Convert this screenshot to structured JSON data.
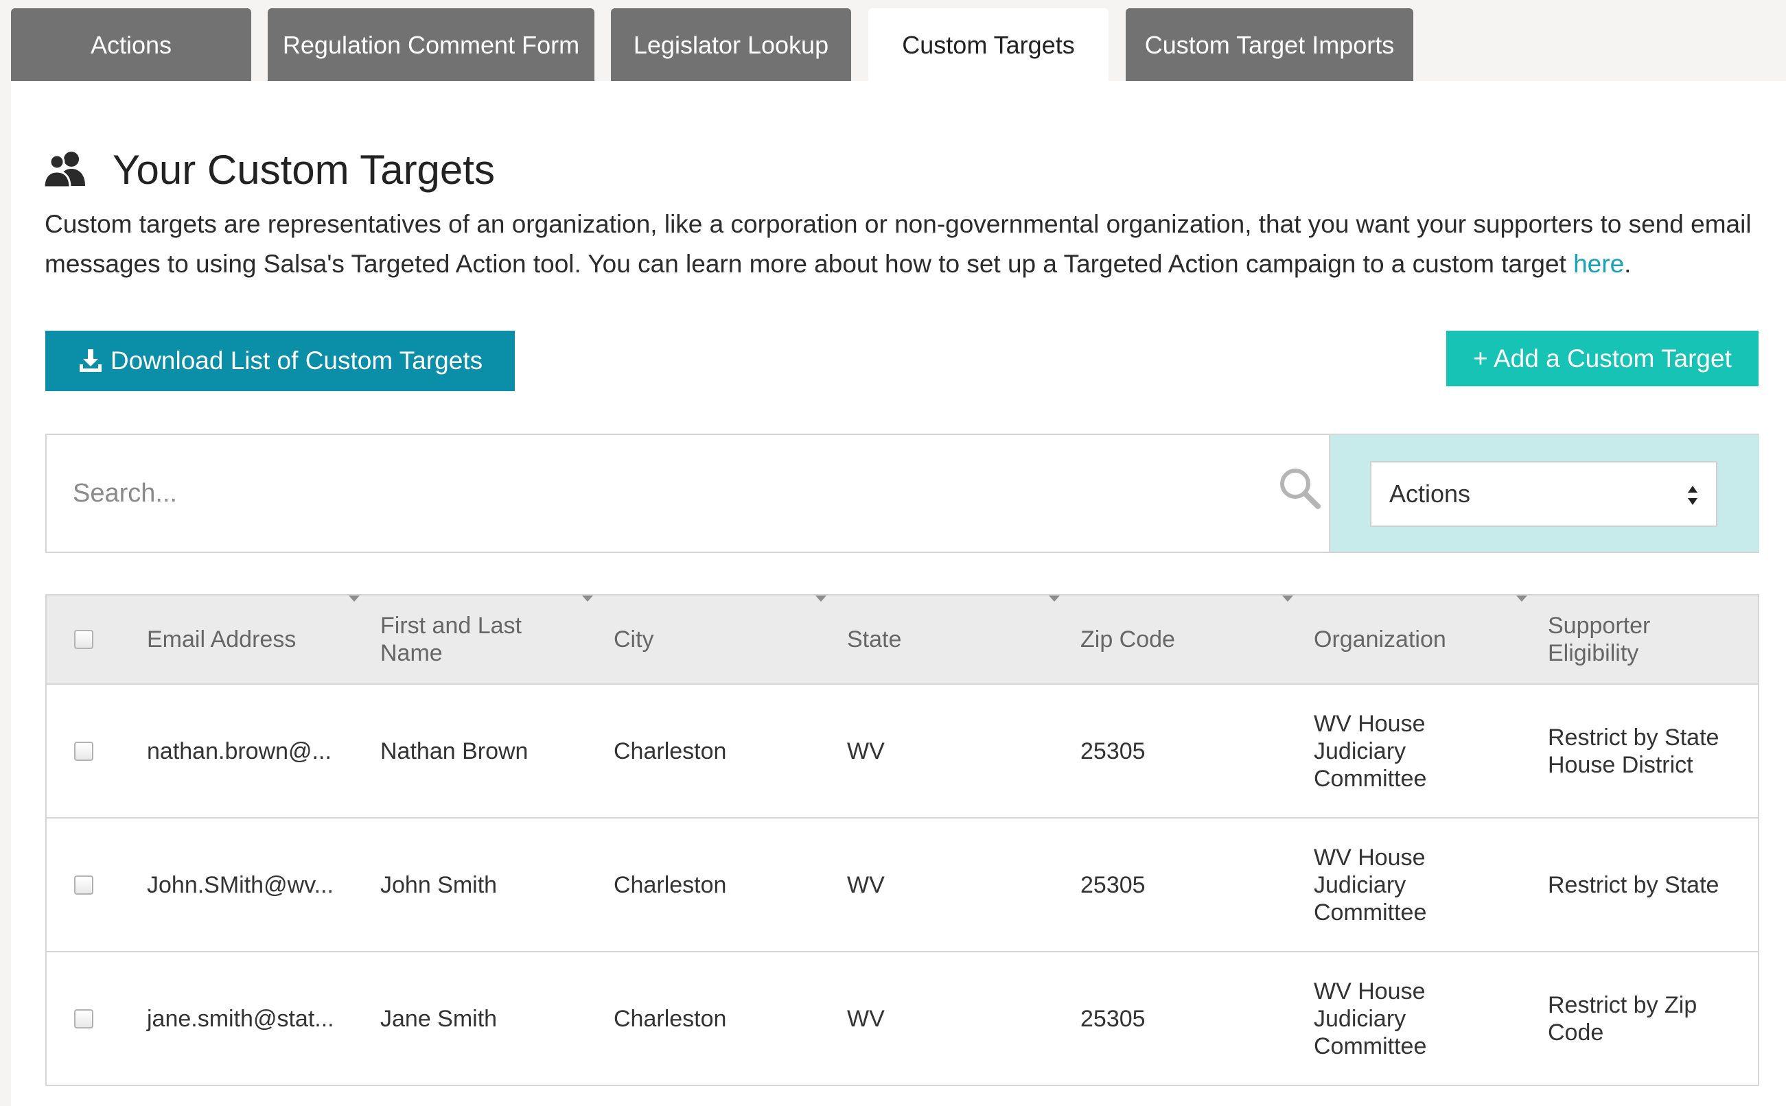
{
  "tabs": [
    {
      "label": "Actions"
    },
    {
      "label": "Regulation Comment Form"
    },
    {
      "label": "Legislator Lookup"
    },
    {
      "label": "Custom Targets",
      "active": true
    },
    {
      "label": "Custom Target Imports"
    }
  ],
  "page": {
    "title": "Your Custom Targets",
    "description": "Custom targets are representatives of an organization, like a corporation or non-governmental organization, that you want your supporters to send email messages to using Salsa's Targeted Action tool. You can learn more about how to set up a Targeted Action campaign to a custom target ",
    "link_text": "here",
    "description_end": "."
  },
  "buttons": {
    "download": "Download List of Custom Targets",
    "add": "+ Add a Custom Target"
  },
  "search": {
    "placeholder": "Search...",
    "actions_selected": "Actions"
  },
  "table": {
    "headers": {
      "email": "Email Address",
      "name": "First and Last Name",
      "city": "City",
      "state": "State",
      "zip": "Zip Code",
      "organization": "Organization",
      "eligibility": "Supporter Eligibility"
    },
    "rows": [
      {
        "email": "nathan.brown@...",
        "name": "Nathan Brown",
        "city": "Charleston",
        "state": "WV",
        "zip": "25305",
        "organization": "WV House Judiciary Committee",
        "eligibility": "Restrict by State House District"
      },
      {
        "email": "John.SMith@wv...",
        "name": "John Smith",
        "city": "Charleston",
        "state": "WV",
        "zip": "25305",
        "organization": "WV House Judiciary Committee",
        "eligibility": "Restrict by State"
      },
      {
        "email": "jane.smith@stat...",
        "name": "Jane Smith",
        "city": "Charleston",
        "state": "WV",
        "zip": "25305",
        "organization": "WV House Judiciary Committee",
        "eligibility": "Restrict by Zip Code"
      }
    ]
  },
  "colors": {
    "tab_inactive": "#727273",
    "download_button": "#0b8fa8",
    "add_button": "#17c3b5",
    "link": "#16a2b8",
    "actions_panel": "#c7eaea"
  },
  "icons": {
    "heading": "users-icon",
    "download": "download-icon",
    "search": "search-icon",
    "select": "select-arrows-icon"
  }
}
